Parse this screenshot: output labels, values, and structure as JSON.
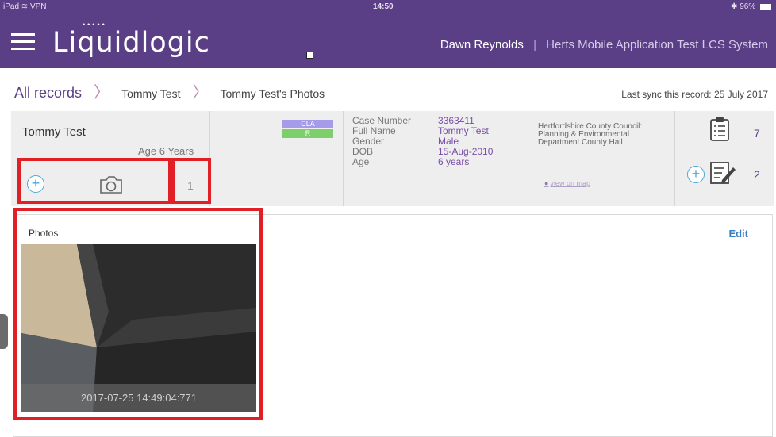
{
  "statusbar": {
    "device": "iPad",
    "network": "VPN",
    "time": "14:50",
    "battery": "96%"
  },
  "header": {
    "logo_text": "Liquidlogic",
    "logo_dots": "•••••",
    "user_name": "Dawn Reynolds",
    "separator": "|",
    "system_name": "Herts Mobile Application Test LCS System"
  },
  "breadcrumb": {
    "root": "All records",
    "person": "Tommy Test",
    "page": "Tommy Test's Photos"
  },
  "last_sync": "Last sync this record: 25 July 2017",
  "person": {
    "name": "Tommy Test",
    "age_label": "Age 6 Years",
    "photo_count": "1",
    "tags": [
      {
        "label": "CLA",
        "color": "#a59be8"
      },
      {
        "label": "R",
        "color": "#7ccf6a"
      }
    ],
    "fields": {
      "labels": [
        "Case Number",
        "Full Name",
        "Gender",
        "DOB",
        "Age"
      ],
      "values": [
        "3363411",
        "Tommy Test",
        "Male",
        "15-Aug-2010",
        "6 years"
      ]
    },
    "address": "Hertfordshire County Council: Planning & Environmental Department County Hall",
    "map_link": "view on map",
    "forms_count": "7",
    "notes_count": "2"
  },
  "photos_section": {
    "title": "Photos",
    "edit_label": "Edit",
    "photo_caption": "2017-07-25 14:49:04:771"
  },
  "colors": {
    "brand": "#5b3f86",
    "accent": "#4aa9d6",
    "highlight": "#e01f26",
    "link": "#3a7fc4"
  }
}
